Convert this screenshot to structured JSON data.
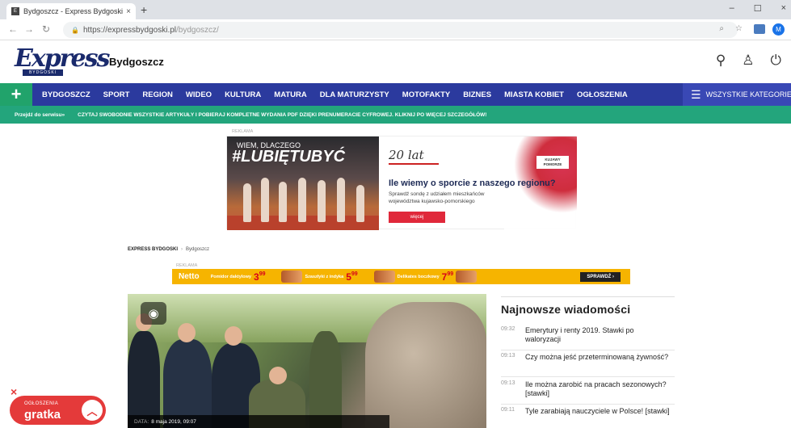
{
  "browser": {
    "tab_title": "Bydgoszcz - Express Bydgoski",
    "tab_favicon": "E",
    "tab_close": "×",
    "new_tab": "+",
    "url_host": "https://expressbydgoski.pl",
    "url_path": "/bydgoszcz/",
    "profile_initial": "M",
    "window_controls": [
      "–",
      "☐",
      "×"
    ]
  },
  "header": {
    "logo_text": "Express",
    "logo_sub": "BYDGOSKI",
    "city": "Bydgoszcz"
  },
  "nav": {
    "plus": "+",
    "items": [
      "BYDGOSZCZ",
      "SPORT",
      "REGION",
      "WIDEO",
      "KULTURA",
      "MATURA",
      "DLA MATURZYSTY",
      "MOTOFAKTY",
      "BIZNES",
      "MIASTA KOBIET",
      "OGŁOSZENIA"
    ],
    "all_categories": "WSZYSTKIE KATEGORIE"
  },
  "promo": {
    "skip": "Przejdź do serwisu»",
    "text": "CZYTAJ SWOBODNIE WSZYSTKIE ARTYKUŁY I POBIERAJ KOMPLETNE WYDANIA PDF DZIĘKI PRENUMERACIE CYFROWEJ. KLIKNIJ PO WIĘCEJ SZCZEGÓŁÓW!"
  },
  "top_ad": {
    "label": "REKLAMA",
    "photo_line1": "WIEM, DLACZEGO",
    "photo_line2": "#LUBIĘTUBYĆ",
    "years": "20 lat",
    "question": "Ile wiemy o sporcie z naszego regionu?",
    "desc": "Sprawdź sondę z udziałem mieszkańców województwa kujawsko-pomorskiego",
    "button": "więcej",
    "brand": "KUJAWY POMORZE"
  },
  "breadcrumb": {
    "root": "EXPRESS BYDGOSKI",
    "sep": "›",
    "current": "Bydgoszcz"
  },
  "netto_ad": {
    "label": "REKLAMA",
    "brand": "Netto",
    "products": [
      {
        "name": "Pomidor daktylowy",
        "price": "3",
        "cents": "99"
      },
      {
        "name": "Szaszłyki z indyka",
        "price": "5",
        "cents": "99"
      },
      {
        "name": "Delikates boczkowy",
        "price": "7",
        "cents": "99"
      }
    ],
    "cta": "SPRAWDŹ ›"
  },
  "hero": {
    "date_label": "DATA:",
    "date": "8 maja 2019, 09:07"
  },
  "latest": {
    "title": "Najnowsze wiadomości",
    "items": [
      {
        "time": "09:32",
        "headline": "Emerytury i renty 2019. Stawki po waloryzacji"
      },
      {
        "time": "09:13",
        "headline": "Czy można jeść przeterminowaną żywność?"
      },
      {
        "time": "09:13",
        "headline": "Ile można zarobić na pracach sezonowych? [stawki]"
      },
      {
        "time": "09:11",
        "headline": "Tyle zarabiają nauczyciele w Polsce! [stawki]"
      }
    ]
  },
  "gratka": {
    "label": "OGŁOSZENIA",
    "logo": "gratka",
    "close": "×"
  }
}
